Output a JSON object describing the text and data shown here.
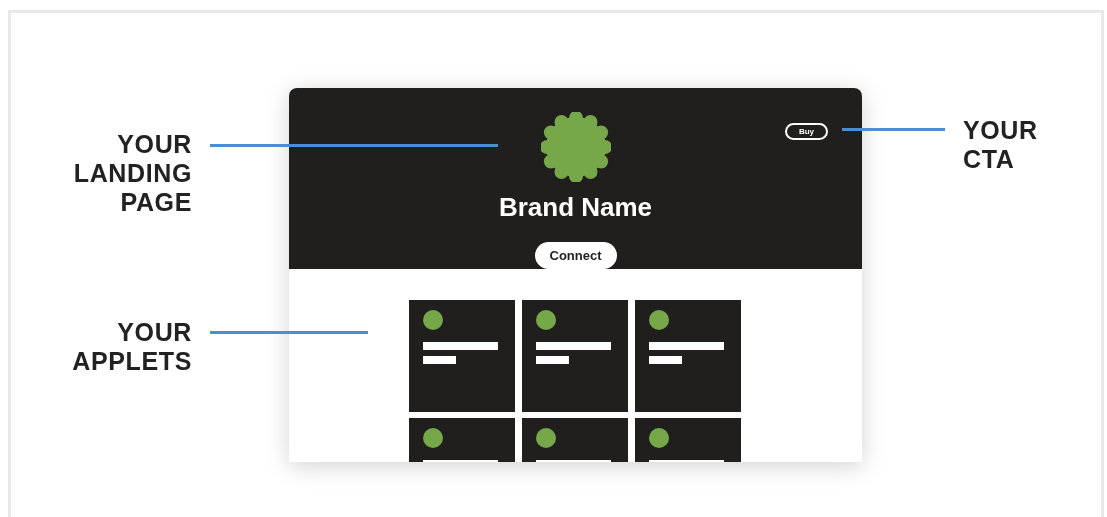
{
  "callouts": [
    {
      "kind": "landing",
      "lines": [
        "YOUR",
        "LANDING",
        "PAGE"
      ]
    },
    {
      "kind": "cta",
      "lines": [
        "YOUR",
        "CTA"
      ]
    },
    {
      "kind": "applets",
      "lines": [
        "YOUR",
        "APPLETS"
      ]
    }
  ],
  "mockup": {
    "brand_name": "Brand Name",
    "connect_button": "Connect",
    "buy_button": "Buy"
  }
}
